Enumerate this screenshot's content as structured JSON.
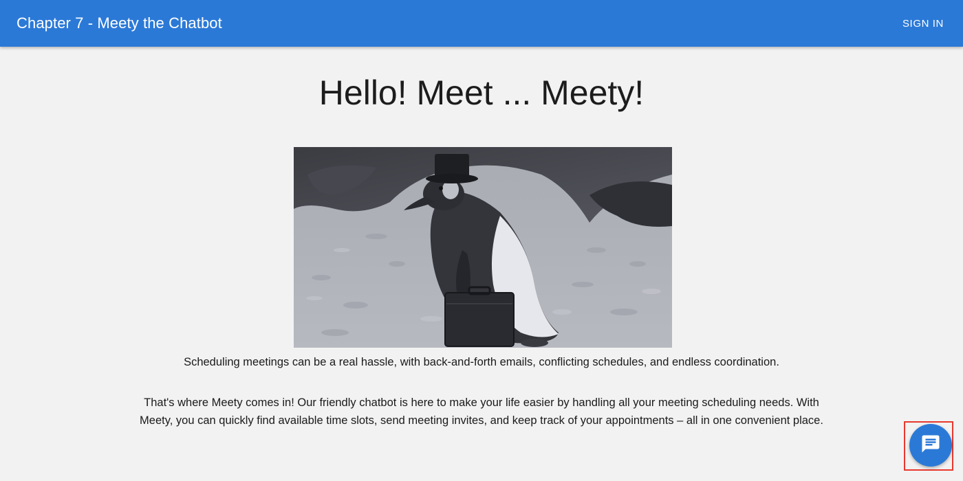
{
  "header": {
    "title": "Chapter 7 - Meety the Chatbot",
    "sign_in_label": "SIGN IN"
  },
  "main": {
    "heading": "Hello! Meet ... Meety!",
    "image_icon": "penguin-with-briefcase-image",
    "paragraphs": [
      "Scheduling meetings can be a real hassle, with back-and-forth emails, conflicting schedules, and endless coordination.",
      "That's where Meety comes in! Our friendly chatbot is here to make your life easier by handling all your meeting scheduling needs. With Meety, you can quickly find available time slots, send meeting invites, and keep track of your appointments – all in one convenient place."
    ]
  },
  "chat": {
    "icon": "chat-bubble-icon"
  },
  "colors": {
    "primary": "#2b79d7",
    "background": "#f2f2f2",
    "highlight": "#e8382e"
  }
}
